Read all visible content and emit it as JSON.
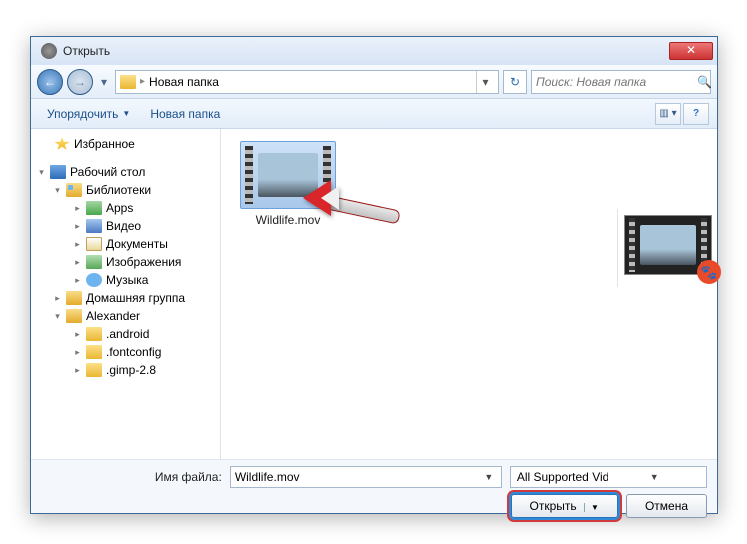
{
  "title": "Открыть",
  "breadcrumb": {
    "label": "Новая папка"
  },
  "search": {
    "placeholder": "Поиск: Новая папка"
  },
  "cmdbar": {
    "organize": "Упорядочить",
    "newfolder": "Новая папка"
  },
  "tree": {
    "favorites": "Избранное",
    "desktop": "Рабочий стол",
    "libraries": "Библиотеки",
    "apps": "Apps",
    "video": "Видео",
    "documents": "Документы",
    "images": "Изображения",
    "music": "Музыка",
    "homegroup": "Домашняя группа",
    "user": "Alexander",
    "f1": ".android",
    "f2": ".fontconfig",
    "f3": ".gimp-2.8"
  },
  "file": {
    "name": "Wildlife.mov"
  },
  "footer": {
    "filename_label": "Имя файла:",
    "filename_value": "Wildlife.mov",
    "filter": "All Supported Video Files (*.rm;",
    "open": "Открыть",
    "cancel": "Отмена"
  }
}
